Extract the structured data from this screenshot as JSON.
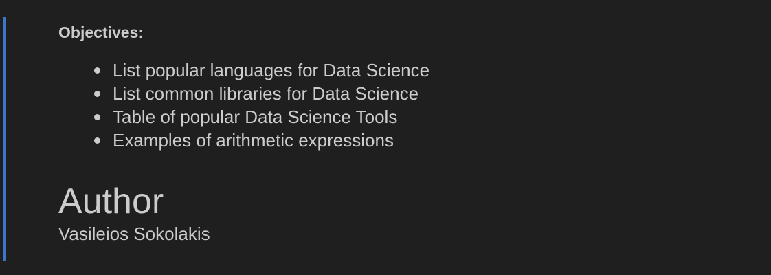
{
  "markdown_cell": {
    "objectives_heading": "Objectives:",
    "objectives": [
      "List popular languages for Data Science",
      "List common libraries for Data Science",
      "Table of popular Data Science Tools",
      "Examples of arithmetic expressions"
    ],
    "author_heading": "Author",
    "author_name": "Vasileios Sokolakis"
  },
  "colors": {
    "background": "#1f1f1f",
    "text": "#cccccc",
    "focus_bar": "#3b78c9"
  }
}
